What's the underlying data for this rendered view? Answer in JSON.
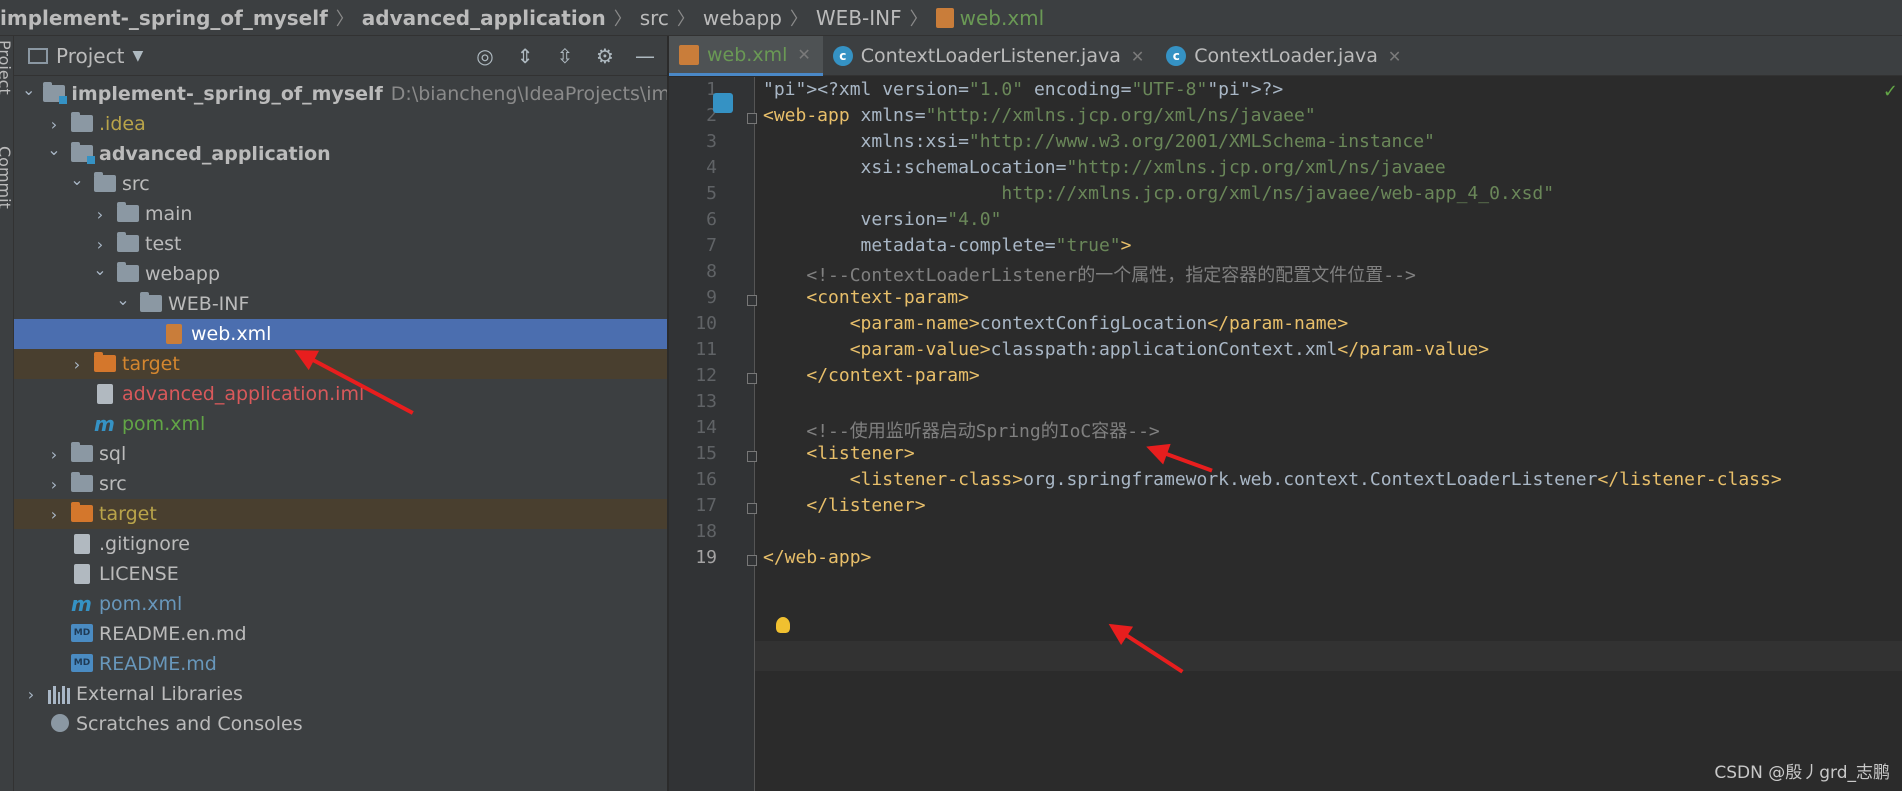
{
  "breadcrumb": [
    "implement-_spring_of_myself",
    "advanced_application",
    "src",
    "webapp",
    "WEB-INF",
    "web.xml"
  ],
  "stripe": {
    "project": "Project",
    "commit": "Commit"
  },
  "project_panel": {
    "title": "Project",
    "tools": [
      "locate-icon",
      "expand-all-icon",
      "collapse-all-icon",
      "gear-icon",
      "minimize-icon"
    ]
  },
  "tree": [
    {
      "label": "implement-_spring_of_myself",
      "path": "D:\\biancheng\\IdeaProjects\\implement-",
      "style": "bold",
      "icon": "module-folder-icon"
    },
    {
      "label": ".idea",
      "style": "yellow",
      "icon": "folder-icon"
    },
    {
      "label": "advanced_application",
      "style": "bold",
      "icon": "module-folder-icon"
    },
    {
      "label": "src",
      "style": "white",
      "icon": "folder-icon"
    },
    {
      "label": "main",
      "style": "white",
      "icon": "folder-icon"
    },
    {
      "label": "test",
      "style": "white",
      "icon": "folder-icon"
    },
    {
      "label": "webapp",
      "style": "white",
      "icon": "folder-icon"
    },
    {
      "label": "WEB-INF",
      "style": "white",
      "icon": "folder-icon"
    },
    {
      "label": "web.xml",
      "style": "sel",
      "icon": "xml-file-icon"
    },
    {
      "label": "target",
      "style": "orange",
      "icon": "excluded-folder-icon"
    },
    {
      "label": "advanced_application.iml",
      "style": "red",
      "icon": "iml-file-icon"
    },
    {
      "label": "pom.xml",
      "style": "green",
      "icon": "maven-icon"
    },
    {
      "label": "sql",
      "style": "white",
      "icon": "folder-icon"
    },
    {
      "label": "src",
      "style": "white",
      "icon": "folder-icon"
    },
    {
      "label": "target",
      "style": "yellow",
      "icon": "excluded-folder-icon"
    },
    {
      "label": ".gitignore",
      "style": "white",
      "icon": "gitignore-file-icon"
    },
    {
      "label": "LICENSE",
      "style": "white",
      "icon": "text-file-icon"
    },
    {
      "label": "pom.xml",
      "style": "blue",
      "icon": "maven-icon"
    },
    {
      "label": "README.en.md",
      "style": "white",
      "icon": "markdown-icon"
    },
    {
      "label": "README.md",
      "style": "blue",
      "icon": "markdown-icon"
    },
    {
      "label": "External Libraries",
      "style": "white",
      "icon": "libraries-icon"
    },
    {
      "label": "Scratches and Consoles",
      "style": "white",
      "icon": "scratches-icon"
    }
  ],
  "tabs": [
    {
      "label": "web.xml",
      "icon": "xml-file-icon",
      "active": true
    },
    {
      "label": "ContextLoaderListener.java",
      "icon": "class-icon",
      "active": false
    },
    {
      "label": "ContextLoader.java",
      "icon": "class-icon",
      "active": false
    }
  ],
  "editor": {
    "line_numbers": [
      "1",
      "2",
      "3",
      "4",
      "5",
      "6",
      "7",
      "8",
      "9",
      "10",
      "11",
      "12",
      "13",
      "14",
      "15",
      "16",
      "17",
      "18",
      "19"
    ],
    "current_line": "19",
    "lines": [
      "<?xml version=\"1.0\" encoding=\"UTF-8\"?>",
      "<web-app xmlns=\"http://xmlns.jcp.org/xml/ns/javaee\"",
      "         xmlns:xsi=\"http://www.w3.org/2001/XMLSchema-instance\"",
      "         xsi:schemaLocation=\"http://xmlns.jcp.org/xml/ns/javaee",
      "                      http://xmlns.jcp.org/xml/ns/javaee/web-app_4_0.xsd\"",
      "         version=\"4.0\"",
      "         metadata-complete=\"true\">",
      "    <!--ContextLoaderListener的一个属性，指定容器的配置文件位置-->",
      "    <context-param>",
      "        <param-name>contextConfigLocation</param-name>",
      "        <param-value>classpath:applicationContext.xml</param-value>",
      "    </context-param>",
      "",
      "    <!--使用监听器启动Spring的IoC容器-->",
      "    <listener>",
      "        <listener-class>org.springframework.web.context.ContextLoaderListener</listener-class>",
      "    </listener>",
      "",
      "</web-app>"
    ]
  },
  "watermark": "CSDN @殷丿grd_志鹏",
  "colors": {
    "selection": "#4b6eaf",
    "tag": "#e8bf6a",
    "string": "#6a8759",
    "comment": "#808080",
    "namespace": "#9876aa",
    "annotation_arrow": "#e81e1e"
  }
}
